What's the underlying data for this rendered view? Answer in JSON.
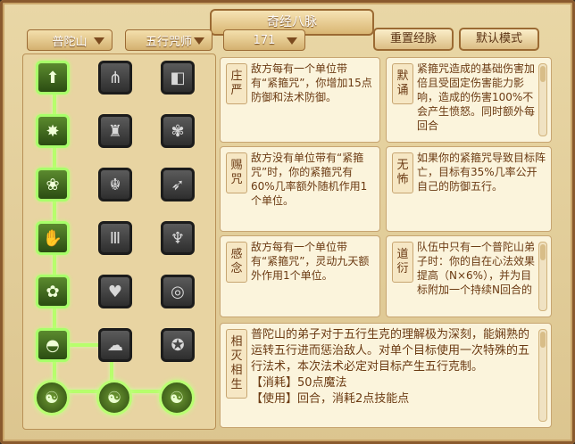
{
  "title": "奇经八脉",
  "filters": {
    "school": "普陀山",
    "faction": "五行咒师",
    "points": "171"
  },
  "buttons": {
    "reset": "重置经脉",
    "default": "默认模式"
  },
  "talents": [
    {
      "name": "庄严",
      "desc": "敌方每有一个单位带有“紧箍咒”，你增加15点防御和法术防御。"
    },
    {
      "name": "默诵",
      "desc": "紧箍咒造成的基础伤害加倍且受固定伤害能力影响，造成的伤害100%不会产生愤怒。同时额外每回合"
    },
    {
      "name": "赐咒",
      "desc": "敌方没有单位带有“紧箍咒”时，你的紧箍咒有60%几率额外随机作用1个单位。"
    },
    {
      "name": "无怖",
      "desc": "如果你的紧箍咒导致目标阵亡，目标有35%几率公开自己的防御五行。"
    },
    {
      "name": "感念",
      "desc": "敌方每有一个单位带有“紧箍咒”，灵动九天额外作用1个单位。"
    },
    {
      "name": "道衍",
      "desc": "队伍中只有一个普陀山弟子时：你的自在心法效果提高（N×6%），并为目标附加一个持续N回合的"
    },
    {
      "name": "相灭相生",
      "desc": "普陀山的弟子对于五行生克的理解极为深刻，能娴熟的运转五行进而惩治敌人。对单个目标使用一次特殊的五行法术，本次法术必定对目标产生五行克制。",
      "cost_label": "【消耗】",
      "cost_value": "50点魔法",
      "extra": "【使用】回合，消耗2点技能点"
    }
  ],
  "icons": {
    "col1": [
      "arrow-lotus-icon",
      "spiky-lotus-icon",
      "lotus-icon",
      "hand-icon",
      "lotus-bloom-icon",
      "bowl-icon"
    ],
    "col2": [
      "stalactite-icon",
      "bell-icon",
      "guardian-icon",
      "bamboo-icon",
      "heart-icon",
      "cloud-icon"
    ],
    "col3": [
      "scroll-icon",
      "lotus-fire-icon",
      "bird-icon",
      "candle-icon",
      "wave-icon",
      "pentagram-icon"
    ],
    "bottom": [
      "yinyang-left-icon",
      "yinyang-center-icon",
      "yinyang-right-icon"
    ]
  }
}
